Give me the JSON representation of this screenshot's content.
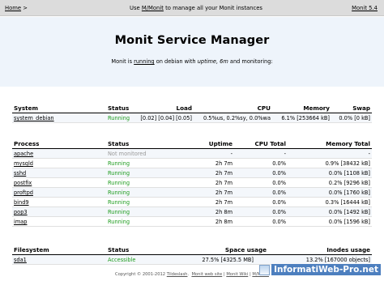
{
  "topbar": {
    "home_label": "Home",
    "home_arrow": ">",
    "manage_prefix": "Use",
    "mmonit_link": "M/Monit",
    "manage_suffix": "to manage all your Monit instances",
    "version_label": "Monit 5.4"
  },
  "banner": {
    "title": "Monit Service Manager",
    "sub_prefix": "Monit is",
    "sub_running": "running",
    "sub_mid": "on debian with",
    "sub_uptime": "uptime, 6m",
    "sub_suffix": "and monitoring:"
  },
  "system_table": {
    "headers": {
      "name": "System",
      "status": "Status",
      "load": "Load",
      "cpu": "CPU",
      "memory": "Memory",
      "swap": "Swap"
    },
    "row": {
      "name": "system_debian",
      "status": "Running",
      "load": "[0.02] [0.04] [0.05]",
      "cpu": "0.5%us, 0.2%sy, 0.0%wa",
      "memory": "6.1% [253664 kB]",
      "swap": "0.0% [0 kB]"
    }
  },
  "process_table": {
    "headers": {
      "name": "Process",
      "status": "Status",
      "uptime": "Uptime",
      "cpu": "CPU Total",
      "memory": "Memory Total"
    },
    "rows": [
      {
        "name": "apache",
        "status": "Not monitored",
        "state": "nm",
        "uptime": "-",
        "cpu": "-",
        "memory": "-"
      },
      {
        "name": "mysqld",
        "status": "Running",
        "state": "ok",
        "uptime": "2h 7m",
        "cpu": "0.0%",
        "memory": "0.9% [38432 kB]"
      },
      {
        "name": "sshd",
        "status": "Running",
        "state": "ok",
        "uptime": "2h 7m",
        "cpu": "0.0%",
        "memory": "0.0% [1108 kB]"
      },
      {
        "name": "postfix",
        "status": "Running",
        "state": "ok",
        "uptime": "2h 7m",
        "cpu": "0.0%",
        "memory": "0.2% [9296 kB]"
      },
      {
        "name": "proftpd",
        "status": "Running",
        "state": "ok",
        "uptime": "2h 7m",
        "cpu": "0.0%",
        "memory": "0.0% [1760 kB]"
      },
      {
        "name": "bind9",
        "status": "Running",
        "state": "ok",
        "uptime": "2h 7m",
        "cpu": "0.0%",
        "memory": "0.3% [16444 kB]"
      },
      {
        "name": "pop3",
        "status": "Running",
        "state": "ok",
        "uptime": "2h 8m",
        "cpu": "0.0%",
        "memory": "0.0% [1492 kB]"
      },
      {
        "name": "imap",
        "status": "Running",
        "state": "ok",
        "uptime": "2h 8m",
        "cpu": "0.0%",
        "memory": "0.0% [1596 kB]"
      }
    ]
  },
  "filesystem_table": {
    "headers": {
      "name": "Filesystem",
      "status": "Status",
      "space": "Space usage",
      "inodes": "Inodes usage"
    },
    "row": {
      "name": "sda1",
      "status": "Accessible",
      "space": "27.5% [4325.5 MB]",
      "inodes": "13.2% [167000 objects]"
    }
  },
  "footer": {
    "copyright": "Copyright © 2001-2012",
    "tildeslash": "Tildeslash",
    "dot1": ".",
    "link_site": "Monit web site",
    "sep1": "|",
    "link_wiki": "Monit Wiki",
    "sep2": "|",
    "link_mmonit": "M/Monit"
  },
  "watermark": {
    "text": "InformatiWeb-Pro.net"
  },
  "colors": {
    "running": "#1d9b1d",
    "not_monitored": "#9a9a9a",
    "banner_bg": "#eef4fb",
    "topbar_bg": "#dcdcdc"
  }
}
